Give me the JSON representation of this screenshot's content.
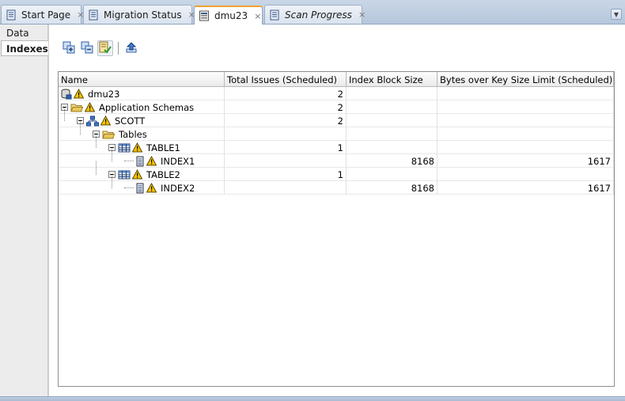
{
  "tabs": [
    {
      "label": "Start Page",
      "icon": "document-icon"
    },
    {
      "label": "Migration Status",
      "icon": "document-icon"
    },
    {
      "label": "dmu23",
      "icon": "database-doc-icon",
      "active": true
    },
    {
      "label": "Scan Progress",
      "icon": "document-icon",
      "italic": true
    }
  ],
  "tab_close_glyph": "×",
  "tabs_menu_glyph": "▼",
  "side_tabs": [
    {
      "label": "Data"
    },
    {
      "label": "Indexes",
      "active": true
    }
  ],
  "toolbar": {
    "buttons": [
      {
        "name": "expand-all-button",
        "icon": "expand-all-icon"
      },
      {
        "name": "collapse-all-button",
        "icon": "collapse-all-icon"
      },
      {
        "name": "show-issues-button",
        "icon": "filter-check-icon",
        "pressed": true
      },
      {
        "name": "export-button",
        "icon": "upload-icon"
      }
    ]
  },
  "grid": {
    "columns": [
      "Name",
      "Total Issues (Scheduled)",
      "Index Block Size",
      "Bytes over Key Size Limit (Scheduled)"
    ],
    "rows": [
      {
        "name": "dmu23",
        "icon": "database-icon",
        "warning": true,
        "level": 0,
        "toggle": "",
        "total_issues": "2",
        "index_block_size": "",
        "bytes_over": ""
      },
      {
        "name": "Application Schemas",
        "icon": "folder-open-icon",
        "warning": true,
        "level": 0,
        "toggle": "minus",
        "total_issues": "2",
        "index_block_size": "",
        "bytes_over": ""
      },
      {
        "name": "SCOTT",
        "icon": "schema-icon",
        "warning": true,
        "level": 1,
        "toggle": "minus",
        "total_issues": "2",
        "index_block_size": "",
        "bytes_over": ""
      },
      {
        "name": "Tables",
        "icon": "folder-open-icon",
        "warning": false,
        "level": 2,
        "toggle": "minus",
        "total_issues": "",
        "index_block_size": "",
        "bytes_over": ""
      },
      {
        "name": "TABLE1",
        "icon": "table-icon",
        "warning": true,
        "level": 3,
        "toggle": "minus",
        "total_issues": "1",
        "index_block_size": "",
        "bytes_over": ""
      },
      {
        "name": "INDEX1",
        "icon": "index-icon",
        "warning": true,
        "level": 4,
        "toggle": "",
        "total_issues": "",
        "index_block_size": "8168",
        "bytes_over": "1617"
      },
      {
        "name": "TABLE2",
        "icon": "table-icon",
        "warning": true,
        "level": 3,
        "toggle": "minus",
        "total_issues": "1",
        "index_block_size": "",
        "bytes_over": ""
      },
      {
        "name": "INDEX2",
        "icon": "index-icon",
        "warning": true,
        "level": 4,
        "toggle": "",
        "total_issues": "",
        "index_block_size": "8168",
        "bytes_over": "1617"
      }
    ]
  },
  "colors": {
    "tab_active_accent": "#f0a030",
    "tabbar_bg": "#bccbde",
    "warning_yellow": "#f5c400",
    "icon_blue": "#2f5fa8",
    "folder_yellow": "#e8c75a"
  }
}
